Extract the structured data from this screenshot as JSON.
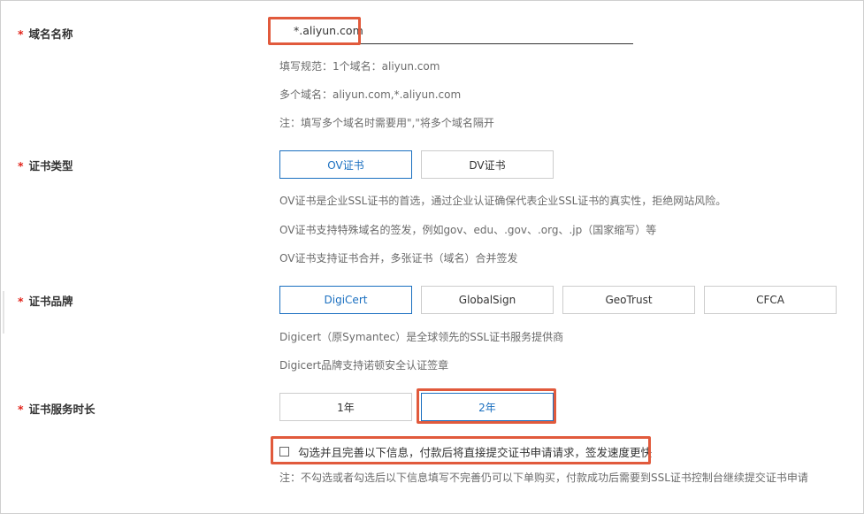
{
  "domain": {
    "label": "域名名称",
    "required_mark": "*",
    "value": "*.aliyun.com",
    "hints": [
      "填写规范：1个域名：aliyun.com",
      "多个域名：aliyun.com,*.aliyun.com",
      "注：填写多个域名时需要用\",\"将多个域名隔开"
    ]
  },
  "cert_type": {
    "label": "证书类型",
    "required_mark": "*",
    "options": [
      "OV证书",
      "DV证书"
    ],
    "selected": "OV证书",
    "hints": [
      "OV证书是企业SSL证书的首选，通过企业认证确保代表企业SSL证书的真实性，拒绝网站风险。",
      "OV证书支持特殊域名的签发，例如gov、edu、.gov、.org、.jp（国家缩写）等",
      "OV证书支持证书合并，多张证书（域名）合并签发"
    ]
  },
  "cert_brand": {
    "label": "证书品牌",
    "required_mark": "*",
    "options": [
      "DigiCert",
      "GlobalSign",
      "GeoTrust",
      "CFCA"
    ],
    "selected": "DigiCert",
    "hints": [
      "Digicert（原Symantec）是全球领先的SSL证书服务提供商",
      "Digicert品牌支持诺顿安全认证签章"
    ]
  },
  "duration": {
    "label": "证书服务时长",
    "required_mark": "*",
    "options": [
      "1年",
      "2年"
    ],
    "selected": "2年"
  },
  "agreement": {
    "checkbox_label": "勾选并且完善以下信息，付款后将直接提交证书申请请求，签发速度更快",
    "checked": false,
    "note": "注：不勾选或者勾选后以下信息填写不完善仍可以下单购买，付款成功后需要到SSL证书控制台继续提交证书申请"
  },
  "colors": {
    "accent": "#1a6fc0",
    "highlight": "#e15a3c",
    "required": "#e2231a"
  }
}
